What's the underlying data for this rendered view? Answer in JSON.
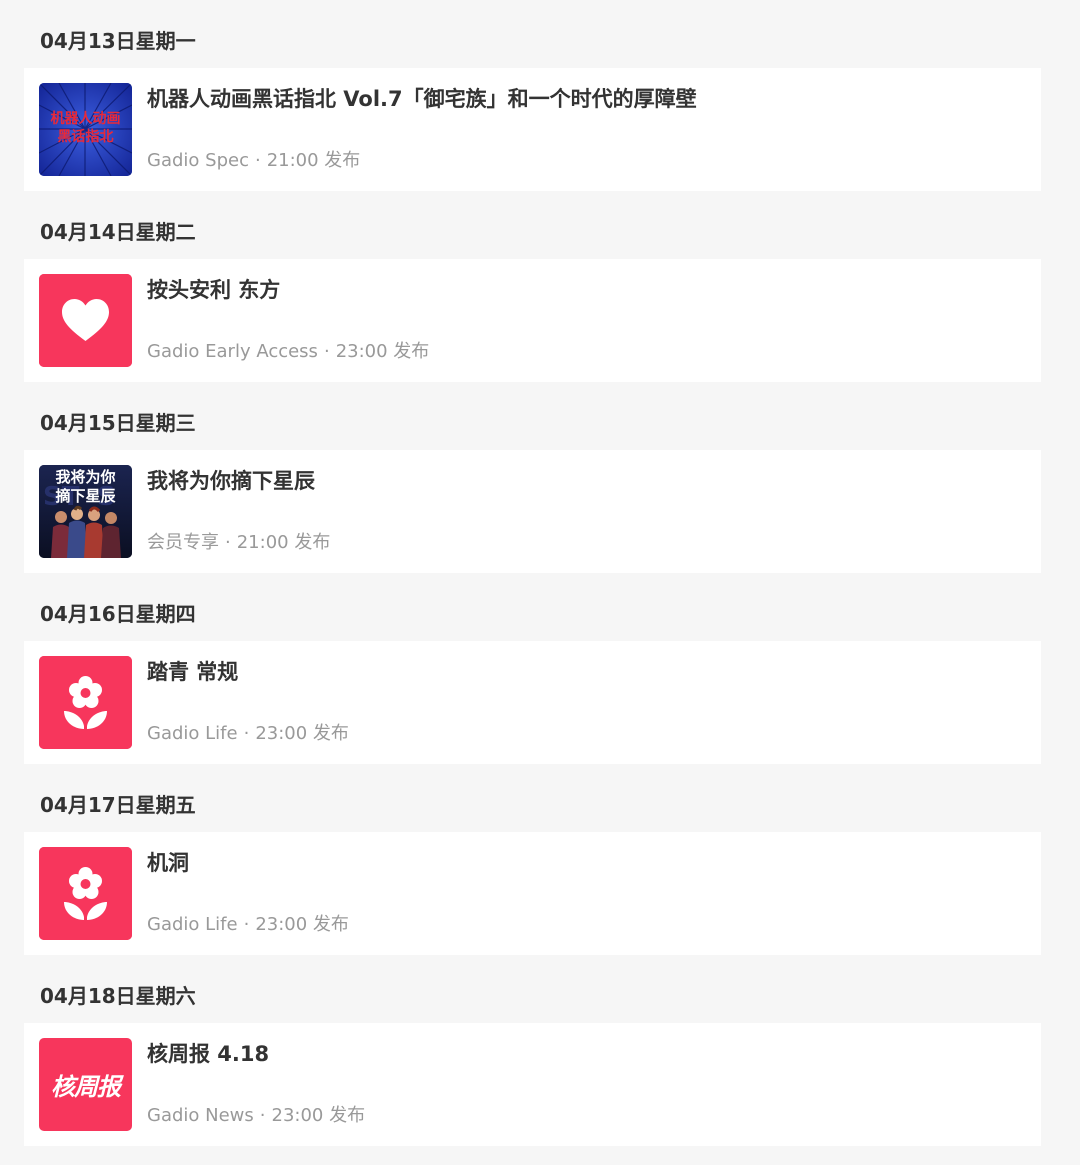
{
  "days": [
    {
      "date": "04月13日星期一",
      "item": {
        "title": "机器人动画黑话指北 Vol.7「御宅族」和一个时代的厚障壁",
        "channel": "Gadio Spec",
        "dot": "·",
        "time": "21:00 发布",
        "thumb": {
          "type": "art-blue",
          "icon": "robot-anime-cover",
          "text_lines": [
            "机器人动画",
            "黑话指北"
          ]
        }
      }
    },
    {
      "date": "04月14日星期二",
      "item": {
        "title": "按头安利 东方",
        "channel": "Gadio Early Access",
        "dot": "·",
        "time": "23:00 发布",
        "thumb": {
          "type": "icon",
          "icon": "heart-icon"
        }
      }
    },
    {
      "date": "04月15日星期三",
      "item": {
        "title": "我将为你摘下星辰",
        "channel": "会员专享",
        "dot": "·",
        "time": "21:00 发布",
        "thumb": {
          "type": "art-dark",
          "icon": "stars-cover",
          "text_lines": [
            "我将为你",
            "摘下星辰"
          ]
        }
      }
    },
    {
      "date": "04月16日星期四",
      "item": {
        "title": "踏青 常规",
        "channel": "Gadio Life",
        "dot": "·",
        "time": "23:00 发布",
        "thumb": {
          "type": "icon",
          "icon": "flower-icon"
        }
      }
    },
    {
      "date": "04月17日星期五",
      "item": {
        "title": "机洞",
        "channel": "Gadio Life",
        "dot": "·",
        "time": "23:00 发布",
        "thumb": {
          "type": "icon",
          "icon": "flower-icon"
        }
      }
    },
    {
      "date": "04月18日星期六",
      "item": {
        "title": "核周报 4.18",
        "channel": "Gadio News",
        "dot": "·",
        "time": "23:00 发布",
        "thumb": {
          "type": "text-logo",
          "icon": "news-logo",
          "text": "核周报"
        }
      }
    }
  ],
  "colors": {
    "page_bg": "#f6f6f6",
    "card_bg": "#ffffff",
    "accent": "#f7365c",
    "title": "#333333",
    "meta": "#999999",
    "cover_blue": "#1f3db8",
    "cover_red_text": "#e8293a"
  }
}
